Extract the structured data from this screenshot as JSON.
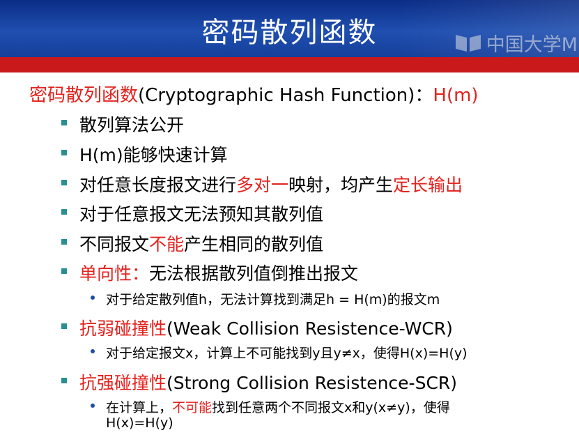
{
  "title": "密码散列函数",
  "watermark_text": "中国大学M",
  "colors": {
    "title_band": "#1f4fb0",
    "red_band": "#c9191b",
    "accent_red": "#e3211c",
    "bullet_teal": "#2a8f91",
    "sub_bullet_blue": "#1b4f9e"
  },
  "main": {
    "term": "密码散列函数",
    "english": "(Cryptographic Hash Function)：",
    "notation": "H(m)"
  },
  "items": [
    {
      "text": "散列算法公开"
    },
    {
      "text": "H(m)能够快速计算"
    },
    {
      "part1": "对任意长度报文进行",
      "red1": "多对一",
      "part2": "映射，均产生",
      "red2": "定长输出"
    },
    {
      "text": "对于任意报文无法预知其散列值"
    },
    {
      "part1": "不同报文",
      "red1": "不能",
      "part2": "产生相同的散列值"
    },
    {
      "red1": "单向性：",
      "part1": "无法根据散列值倒推出报文",
      "sub": "对于给定散列值h，无法计算找到满足h = H(m)的报文m"
    },
    {
      "red1": "抗弱碰撞性",
      "part1": "(Weak Collision Resistence-WCR)",
      "sub": "对于给定报文x，计算上不可能找到y且y≠x，使得H(x)=H(y)"
    },
    {
      "red1": "抗强碰撞性",
      "part1": "(Strong Collision Resistence-SCR)",
      "sub_part1": "在计算上，",
      "sub_red": "不可能",
      "sub_part2": "找到任意两个不同报文x和y(x≠y)，使得",
      "sub_line2": "H(x)=H(y)"
    }
  ]
}
